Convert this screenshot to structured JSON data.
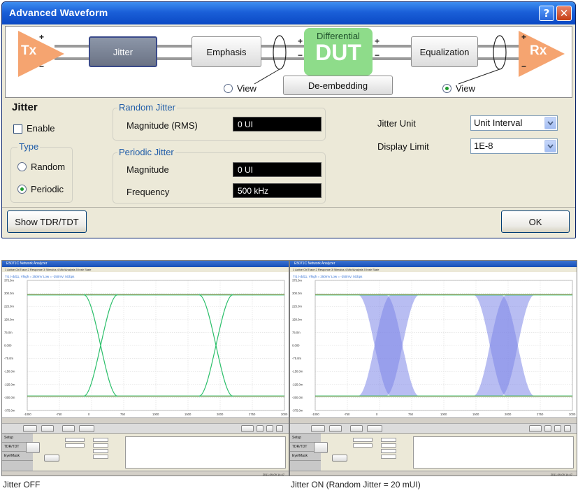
{
  "dialog": {
    "title": "Advanced Waveform",
    "help_glyph": "?",
    "close_glyph": "✕",
    "diagram": {
      "tx": "Tx",
      "rx": "Rx",
      "plus": "+",
      "minus": "−",
      "jitter_button": "Jitter",
      "emphasis_button": "Emphasis",
      "dut_label_top": "Differential",
      "dut_label": "DUT",
      "deembedding_button": "De-embedding",
      "equalization_button": "Equalization",
      "view_left_label": "View",
      "view_left_selected": false,
      "view_right_label": "View",
      "view_right_selected": true
    },
    "jitter": {
      "heading": "Jitter",
      "enable_label": "Enable",
      "enable_checked": false,
      "type_group_title": "Type",
      "type_options": [
        "Random",
        "Periodic"
      ],
      "type_selected": "Periodic",
      "random_group_title": "Random Jitter",
      "magnitude_rms_label": "Magnitude (RMS)",
      "magnitude_rms_value": "0 UI",
      "periodic_group_title": "Periodic Jitter",
      "magnitude_label": "Magnitude",
      "magnitude_value": "0 UI",
      "frequency_label": "Frequency",
      "frequency_value": "500 kHz",
      "jitter_unit_label": "Jitter Unit",
      "jitter_unit_value": "Unit Interval",
      "display_limit_label": "Display Limit",
      "display_limit_value": "1E-8"
    },
    "show_tdr_button": "Show TDR/TDT",
    "ok_button": "OK"
  },
  "screenshots": [
    {
      "caption": "Jitter OFF",
      "window_title": "E5071C Network Analyzer",
      "menu": "1 Active Ch/Trace   2 Response   3 Stimulus   4 Mkr/Analysis   5 Instr State",
      "trace_label": "Tr1 t-dd11, Vhigh = 250mV Low = -250mV, 5Gbps",
      "y_ticks": [
        "375.0m",
        "300.0m",
        "225.0m",
        "150.0m",
        "75.0m",
        "0.000",
        "-75.0m",
        "-150.0m",
        "-225.0m",
        "-300.0m",
        "-375.0m"
      ],
      "x_ticks": [
        "-1000",
        "-750",
        "0",
        "750",
        "1000",
        "1500",
        "2000",
        "2750",
        "3000"
      ],
      "timestamp": "2011-09-09 14:47",
      "side_tabs": [
        "Setup",
        "TDR/TDT",
        "Eye/Mask"
      ]
    },
    {
      "caption": "Jitter ON (Random Jitter = 20 mUI)",
      "window_title": "E5071C Network Analyzer",
      "menu": "1 Active Ch/Trace   2 Response   3 Stimulus   4 Mkr/Analysis   5 Instr State",
      "trace_label": "Tr1 t-dd11, Vhigh = 250mV Low = -250mV, 5Gbps",
      "y_ticks": [
        "375.0m",
        "300.0m",
        "225.0m",
        "150.0m",
        "75.0m",
        "0.000",
        "-75.0m",
        "-150.0m",
        "-225.0m",
        "-300.0m",
        "-375.0m"
      ],
      "x_ticks": [
        "-1000",
        "-750",
        "0",
        "750",
        "1000",
        "1500",
        "2000",
        "2750",
        "3000"
      ],
      "timestamp": "2011-09-09 14:47",
      "side_tabs": [
        "Setup",
        "TDR/TDT",
        "Eye/Mask"
      ]
    }
  ],
  "colors": {
    "triangle": "#f5a470",
    "dut": "#8edc8a",
    "eye_trace": "#2bbf6a",
    "jitter_band": "#7e86e8"
  }
}
